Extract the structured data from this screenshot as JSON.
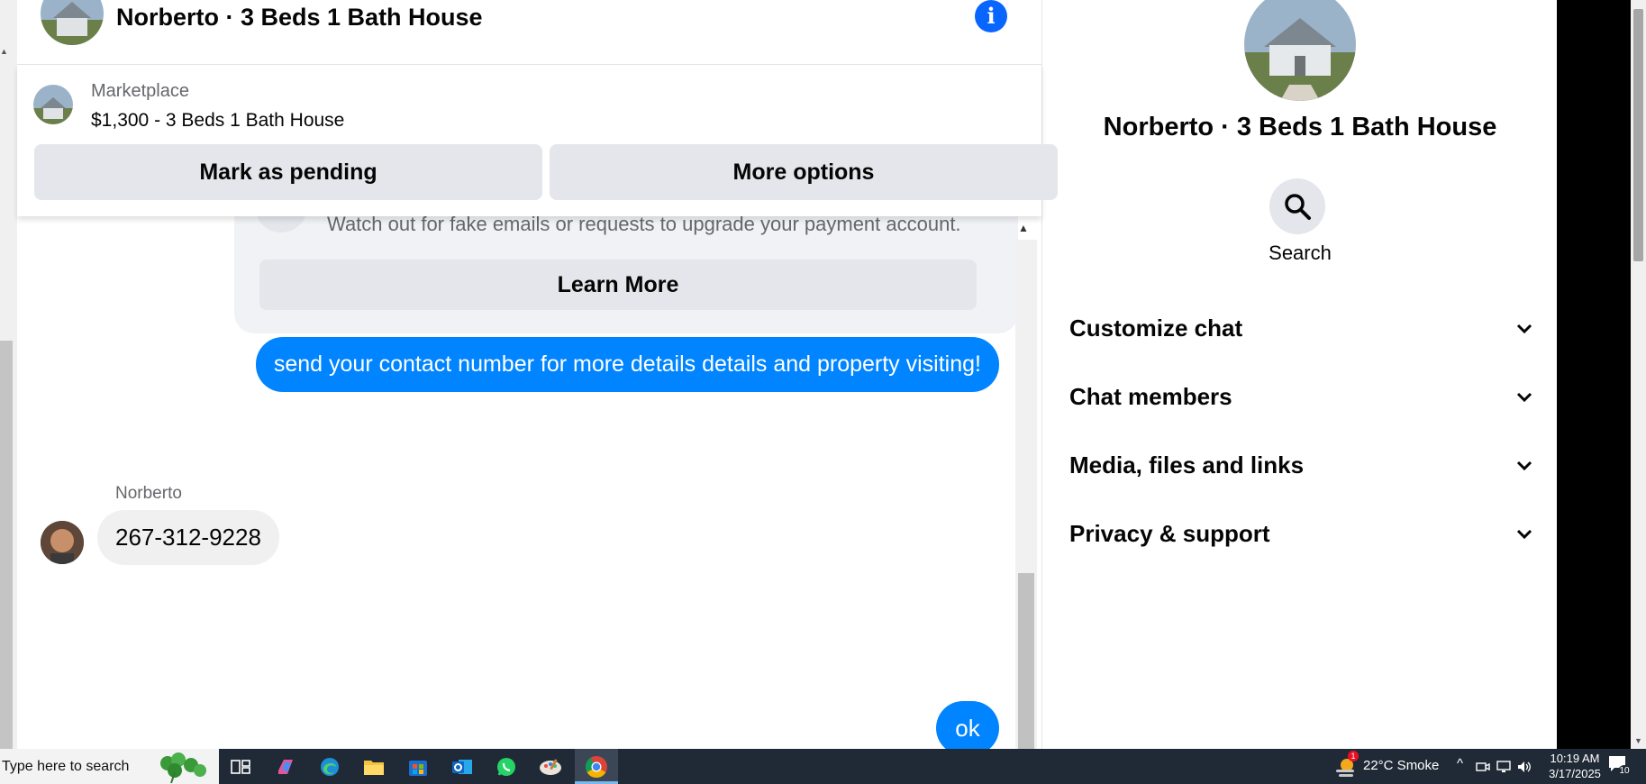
{
  "chat": {
    "header_title": "Norberto · 3 Beds 1 Bath House",
    "marketplace_label": "Marketplace",
    "listing": "$1,300 - 3 Beds 1 Bath House",
    "mark_pending": "Mark as pending",
    "more_options": "More options",
    "warning_text": "Watch out for fake emails or requests to upgrade your payment account.",
    "learn_more": "Learn More",
    "messages": {
      "outgoing_1": "send your contact number for more details details and property visiting!",
      "sender": "Norberto",
      "incoming_1": "267-312-9228",
      "outgoing_2": "ok"
    }
  },
  "side_panel": {
    "title": "Norberto · 3 Beds 1 Bath House",
    "search_label": "Search",
    "sections": [
      "Customize chat",
      "Chat members",
      "Media, files and links",
      "Privacy & support"
    ]
  },
  "taskbar": {
    "search_placeholder": "Type here to search",
    "weather": "22°C  Smoke",
    "weather_badge": "1",
    "time": "10:19 AM",
    "date": "3/17/2025",
    "notification_count": "10"
  },
  "colors": {
    "messenger_blue": "#0084ff",
    "info_blue": "#0866ff",
    "button_gray": "#e4e6eb",
    "taskbar": "#202a36"
  }
}
